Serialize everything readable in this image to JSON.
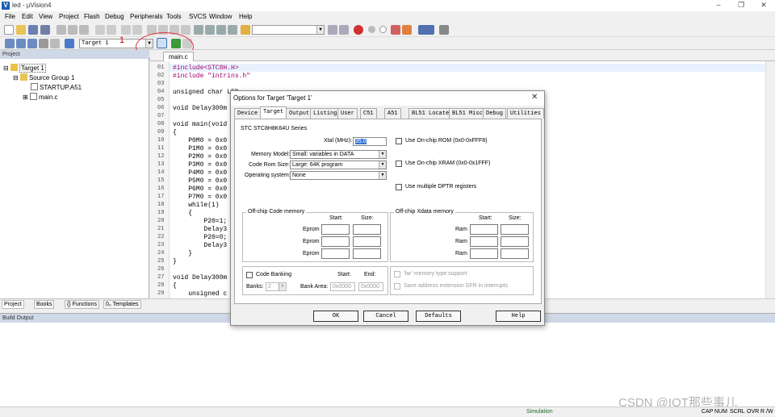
{
  "window": {
    "title": "led - µVision4",
    "minimize": "–",
    "maximize": "❐",
    "close": "✕"
  },
  "menu": [
    "File",
    "Edit",
    "View",
    "Project",
    "Flash",
    "Debug",
    "Peripherals",
    "Tools",
    "SVCS",
    "Window",
    "Help"
  ],
  "toolbar": {
    "target_select": "Target 1",
    "annotation_number": "1"
  },
  "project_pane": {
    "header": "Project",
    "tree": [
      "Target 1",
      "Source Group 1",
      "STARTUP.A51",
      "main.c"
    ],
    "tabs": [
      "Project",
      "Books",
      "{} Functions",
      "0₀ Templates"
    ]
  },
  "editor": {
    "tab": "main.c",
    "line_numbers": [
      "01",
      "02",
      "03",
      "04",
      "05",
      "06",
      "07",
      "08",
      "09",
      "10",
      "11",
      "12",
      "13",
      "14",
      "15",
      "16",
      "17",
      "18",
      "19",
      "20",
      "21",
      "22",
      "23",
      "24",
      "25",
      "26",
      "27",
      "28",
      "29"
    ],
    "lines": [
      "#include<STC8H.H>",
      "#include \"intrins.h\"",
      "",
      "unsigned char LED",
      "",
      "void Delay300m",
      "",
      "void main(void",
      "{",
      "    P0M0 = 0x0",
      "    P1M0 = 0x0",
      "    P2M0 = 0x0",
      "    P3M0 = 0x0",
      "    P4M0 = 0x0",
      "    P5M0 = 0x0",
      "    P6M0 = 0x0",
      "    P7M0 = 0x0",
      "    while(1)",
      "    {",
      "        P20=1;",
      "        Delay3",
      "        P20=0;",
      "        Delay3",
      "    }",
      "}",
      "",
      "void Delay300m",
      "{",
      "    unsigned c"
    ]
  },
  "build_output": {
    "header": "Build Output"
  },
  "status": {
    "mode": "Simulation",
    "indicators": [
      "CAP",
      "NUM",
      "SCRL",
      "OVR",
      "R /W"
    ]
  },
  "watermark": "CSDN @IOT那些事儿",
  "dialog": {
    "title": "Options for Target 'Target 1'",
    "close": "✕",
    "tabs": [
      "Device",
      "Target",
      "Output",
      "Listing",
      "User",
      "C51",
      "A51",
      "BL51 Locate",
      "BL51 Misc",
      "Debug",
      "Utilities"
    ],
    "active_tab": "Target",
    "device": "STC STC8H8K64U Series",
    "xtal_label": "Xtal (MHz):",
    "xtal_value": "35.0",
    "memory_model_label": "Memory Model:",
    "memory_model_value": "Small: variables in DATA",
    "code_rom_label": "Code Rom Size:",
    "code_rom_value": "Large: 64K program",
    "os_label": "Operating system:",
    "os_value": "None",
    "use_onchip_rom": "Use On-chip ROM (0x0-0xFFF8)",
    "use_onchip_xram": "Use On-chip XRAM (0x0-0x1FFF)",
    "use_multiple_dptr": "Use multiple DPTR registers",
    "offchip_code": "Off-chip Code memory",
    "offchip_xdata": "Off-chip Xdata memory",
    "start_label": "Start:",
    "size_label": "Size:",
    "eprom_label": "Eprom",
    "ram_label": "Ram",
    "code_banking": "Code Banking",
    "banks_label": "Banks:",
    "banks_value": "2",
    "bank_area_label": "Bank Area:",
    "end_label": "End:",
    "bank_start": "0x0000",
    "bank_end": "0x0000",
    "far_memory": "'far' memory type support",
    "save_sfr": "Save address extension SFR in interrupts",
    "buttons": {
      "ok": "OK",
      "cancel": "Cancel",
      "defaults": "Defaults",
      "help": "Help"
    }
  }
}
